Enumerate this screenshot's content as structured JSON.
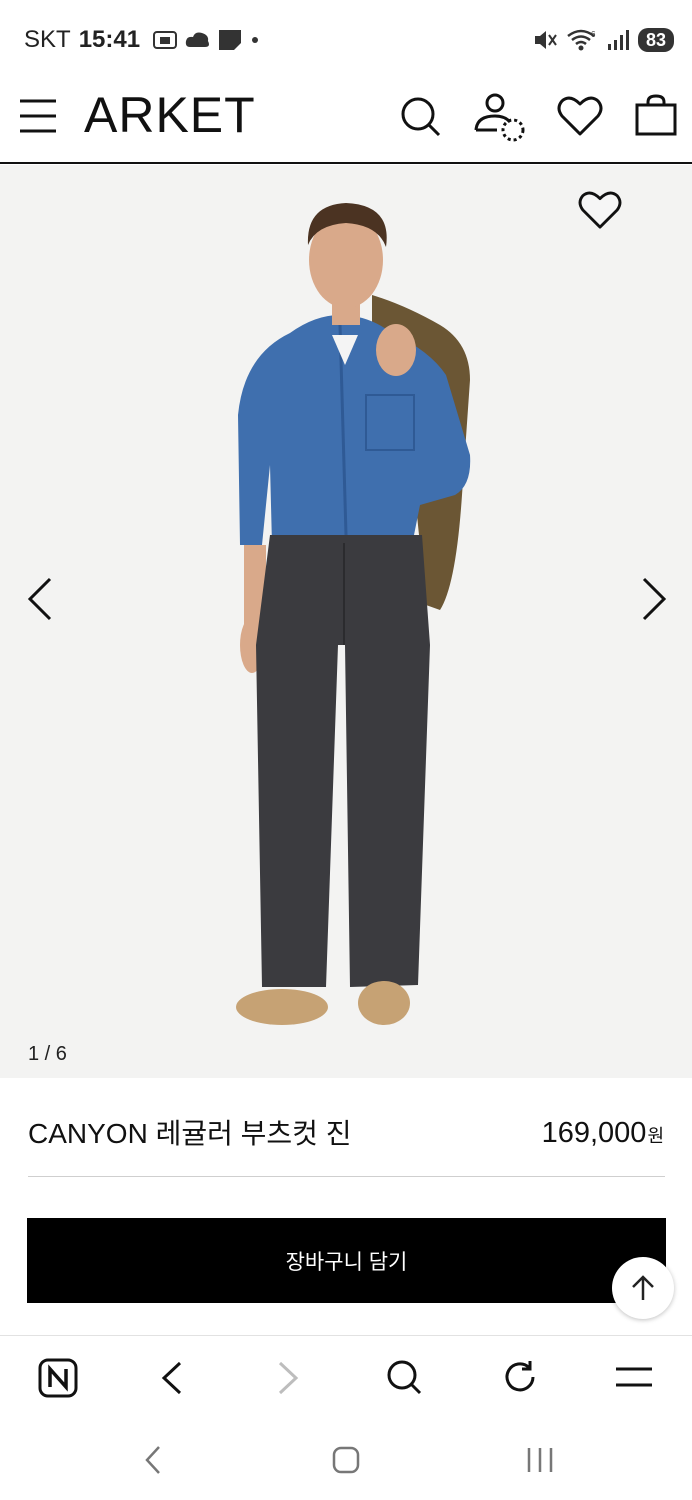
{
  "status_bar": {
    "carrier": "SKT",
    "time": "15:41",
    "battery": "83",
    "icons": [
      "screenshot-icon",
      "cloud-icon",
      "note-icon",
      "dot-icon",
      "mute-icon",
      "wifi-icon",
      "signal-icon"
    ]
  },
  "header": {
    "brand": "ARKET",
    "icons": [
      "menu-icon",
      "search-icon",
      "account-icon",
      "wishlist-icon",
      "bag-icon"
    ]
  },
  "gallery": {
    "counter": "1 / 6",
    "icons": [
      "favorite-icon",
      "prev-arrow-icon",
      "next-arrow-icon"
    ]
  },
  "product": {
    "name": "CANYON 레귤러 부츠컷 진",
    "price": "169,000",
    "currency": "원"
  },
  "actions": {
    "add_to_cart": "장바구니 담기"
  },
  "browser_toolbar": {
    "items": [
      "naver-home-icon",
      "back-icon",
      "forward-icon",
      "search-icon",
      "reload-icon",
      "menu-icon"
    ]
  },
  "system_nav": {
    "items": [
      "back-icon",
      "home-icon",
      "recents-icon"
    ]
  },
  "colors": {
    "button_bg": "#000000",
    "image_bg": "#f3f3f2",
    "text": "#111111"
  }
}
